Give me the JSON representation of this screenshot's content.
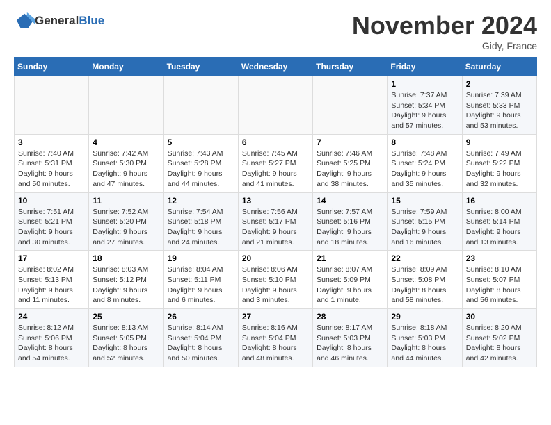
{
  "header": {
    "logo_general": "General",
    "logo_blue": "Blue",
    "month_title": "November 2024",
    "location": "Gidy, France"
  },
  "weekdays": [
    "Sunday",
    "Monday",
    "Tuesday",
    "Wednesday",
    "Thursday",
    "Friday",
    "Saturday"
  ],
  "weeks": [
    [
      {
        "day": "",
        "info": ""
      },
      {
        "day": "",
        "info": ""
      },
      {
        "day": "",
        "info": ""
      },
      {
        "day": "",
        "info": ""
      },
      {
        "day": "",
        "info": ""
      },
      {
        "day": "1",
        "info": "Sunrise: 7:37 AM\nSunset: 5:34 PM\nDaylight: 9 hours and 57 minutes."
      },
      {
        "day": "2",
        "info": "Sunrise: 7:39 AM\nSunset: 5:33 PM\nDaylight: 9 hours and 53 minutes."
      }
    ],
    [
      {
        "day": "3",
        "info": "Sunrise: 7:40 AM\nSunset: 5:31 PM\nDaylight: 9 hours and 50 minutes."
      },
      {
        "day": "4",
        "info": "Sunrise: 7:42 AM\nSunset: 5:30 PM\nDaylight: 9 hours and 47 minutes."
      },
      {
        "day": "5",
        "info": "Sunrise: 7:43 AM\nSunset: 5:28 PM\nDaylight: 9 hours and 44 minutes."
      },
      {
        "day": "6",
        "info": "Sunrise: 7:45 AM\nSunset: 5:27 PM\nDaylight: 9 hours and 41 minutes."
      },
      {
        "day": "7",
        "info": "Sunrise: 7:46 AM\nSunset: 5:25 PM\nDaylight: 9 hours and 38 minutes."
      },
      {
        "day": "8",
        "info": "Sunrise: 7:48 AM\nSunset: 5:24 PM\nDaylight: 9 hours and 35 minutes."
      },
      {
        "day": "9",
        "info": "Sunrise: 7:49 AM\nSunset: 5:22 PM\nDaylight: 9 hours and 32 minutes."
      }
    ],
    [
      {
        "day": "10",
        "info": "Sunrise: 7:51 AM\nSunset: 5:21 PM\nDaylight: 9 hours and 30 minutes."
      },
      {
        "day": "11",
        "info": "Sunrise: 7:52 AM\nSunset: 5:20 PM\nDaylight: 9 hours and 27 minutes."
      },
      {
        "day": "12",
        "info": "Sunrise: 7:54 AM\nSunset: 5:18 PM\nDaylight: 9 hours and 24 minutes."
      },
      {
        "day": "13",
        "info": "Sunrise: 7:56 AM\nSunset: 5:17 PM\nDaylight: 9 hours and 21 minutes."
      },
      {
        "day": "14",
        "info": "Sunrise: 7:57 AM\nSunset: 5:16 PM\nDaylight: 9 hours and 18 minutes."
      },
      {
        "day": "15",
        "info": "Sunrise: 7:59 AM\nSunset: 5:15 PM\nDaylight: 9 hours and 16 minutes."
      },
      {
        "day": "16",
        "info": "Sunrise: 8:00 AM\nSunset: 5:14 PM\nDaylight: 9 hours and 13 minutes."
      }
    ],
    [
      {
        "day": "17",
        "info": "Sunrise: 8:02 AM\nSunset: 5:13 PM\nDaylight: 9 hours and 11 minutes."
      },
      {
        "day": "18",
        "info": "Sunrise: 8:03 AM\nSunset: 5:12 PM\nDaylight: 9 hours and 8 minutes."
      },
      {
        "day": "19",
        "info": "Sunrise: 8:04 AM\nSunset: 5:11 PM\nDaylight: 9 hours and 6 minutes."
      },
      {
        "day": "20",
        "info": "Sunrise: 8:06 AM\nSunset: 5:10 PM\nDaylight: 9 hours and 3 minutes."
      },
      {
        "day": "21",
        "info": "Sunrise: 8:07 AM\nSunset: 5:09 PM\nDaylight: 9 hours and 1 minute."
      },
      {
        "day": "22",
        "info": "Sunrise: 8:09 AM\nSunset: 5:08 PM\nDaylight: 8 hours and 58 minutes."
      },
      {
        "day": "23",
        "info": "Sunrise: 8:10 AM\nSunset: 5:07 PM\nDaylight: 8 hours and 56 minutes."
      }
    ],
    [
      {
        "day": "24",
        "info": "Sunrise: 8:12 AM\nSunset: 5:06 PM\nDaylight: 8 hours and 54 minutes."
      },
      {
        "day": "25",
        "info": "Sunrise: 8:13 AM\nSunset: 5:05 PM\nDaylight: 8 hours and 52 minutes."
      },
      {
        "day": "26",
        "info": "Sunrise: 8:14 AM\nSunset: 5:04 PM\nDaylight: 8 hours and 50 minutes."
      },
      {
        "day": "27",
        "info": "Sunrise: 8:16 AM\nSunset: 5:04 PM\nDaylight: 8 hours and 48 minutes."
      },
      {
        "day": "28",
        "info": "Sunrise: 8:17 AM\nSunset: 5:03 PM\nDaylight: 8 hours and 46 minutes."
      },
      {
        "day": "29",
        "info": "Sunrise: 8:18 AM\nSunset: 5:03 PM\nDaylight: 8 hours and 44 minutes."
      },
      {
        "day": "30",
        "info": "Sunrise: 8:20 AM\nSunset: 5:02 PM\nDaylight: 8 hours and 42 minutes."
      }
    ]
  ]
}
